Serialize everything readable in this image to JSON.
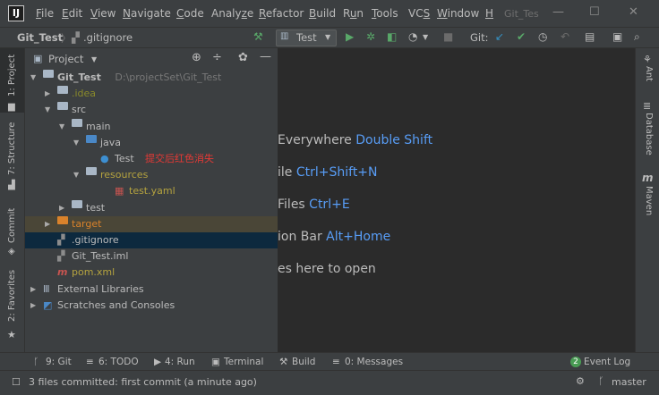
{
  "menubar": {
    "items": [
      "File",
      "Edit",
      "View",
      "Navigate",
      "Code",
      "Analyze",
      "Refactor",
      "Build",
      "Run",
      "Tools",
      "VCS",
      "Window",
      "H"
    ],
    "mnemonics": [
      "F",
      "E",
      "V",
      "N",
      "C",
      "z",
      "R",
      "B",
      "u",
      "T",
      "S",
      "W",
      "H"
    ],
    "title": "Git_Tes"
  },
  "navbar": {
    "project": "Git_Test",
    "file": ".gitignore",
    "run_config": "Test",
    "git_label": "Git:"
  },
  "left_tabs": [
    "1: Project",
    "7: Structure",
    "Commit",
    "2: Favorites"
  ],
  "right_tabs": [
    "Ant",
    "Database",
    "Maven"
  ],
  "project_panel": {
    "title": "Project",
    "tree": [
      {
        "label": "Git_Test",
        "path": "D:\\projectSet\\Git_Test",
        "depth": 0,
        "icon": "folder",
        "expanded": true,
        "color": "#bbbbbb",
        "bold": true
      },
      {
        "label": ".idea",
        "depth": 1,
        "icon": "folder",
        "expanded": false,
        "color": "#8a8a2a"
      },
      {
        "label": "src",
        "depth": 1,
        "icon": "folder",
        "expanded": true,
        "color": "#bbbbbb"
      },
      {
        "label": "main",
        "depth": 2,
        "icon": "folder",
        "expanded": true,
        "color": "#bbbbbb"
      },
      {
        "label": "java",
        "depth": 3,
        "icon": "folder-blue",
        "expanded": true,
        "color": "#bbbbbb"
      },
      {
        "label": "Test",
        "note": "提交后红色消失",
        "depth": 4,
        "icon": "class",
        "color": "#bbbbbb"
      },
      {
        "label": "resources",
        "depth": 3,
        "icon": "folder-res",
        "expanded": true,
        "color": "#b5a33f"
      },
      {
        "label": "test.yaml",
        "depth": 5,
        "icon": "yaml",
        "color": "#b5a33f"
      },
      {
        "label": "test",
        "depth": 2,
        "icon": "folder",
        "expanded": false,
        "color": "#bbbbbb"
      },
      {
        "label": "target",
        "depth": 1,
        "icon": "folder-orange",
        "expanded": false,
        "color": "#d9822b",
        "highlight": "#4a4637"
      },
      {
        "label": ".gitignore",
        "depth": 1,
        "icon": "gitignore",
        "color": "#bbbbbb",
        "selected": true
      },
      {
        "label": "Git_Test.iml",
        "depth": 1,
        "icon": "iml",
        "color": "#bbbbbb"
      },
      {
        "label": "pom.xml",
        "depth": 1,
        "icon": "maven",
        "color": "#b5a33f"
      },
      {
        "label": "External Libraries",
        "depth": 0,
        "icon": "libs",
        "expanded": false,
        "color": "#bbbbbb"
      },
      {
        "label": "Scratches and Consoles",
        "depth": 0,
        "icon": "scratch",
        "expanded": false,
        "color": "#bbbbbb"
      }
    ]
  },
  "editor_hints": [
    {
      "text": "Everywhere ",
      "key": "Double Shift"
    },
    {
      "text": "ile ",
      "key": "Ctrl+Shift+N"
    },
    {
      "text": "Files ",
      "key": "Ctrl+E"
    },
    {
      "text": "ion Bar ",
      "key": "Alt+Home"
    },
    {
      "text": "es here to open",
      "key": ""
    }
  ],
  "bottom_tabs": [
    "9: Git",
    "6: TODO",
    "4: Run",
    "Terminal",
    "Build",
    "0: Messages"
  ],
  "event_log": {
    "badge": "2",
    "label": "Event Log"
  },
  "status": {
    "message": "3 files committed: first commit (a minute ago)",
    "branch": "master"
  }
}
